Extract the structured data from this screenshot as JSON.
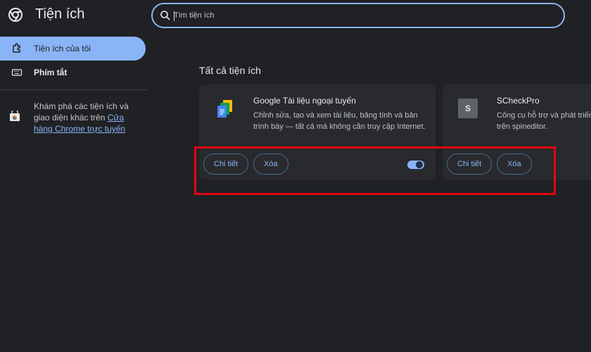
{
  "header": {
    "title": "Tiện ích",
    "logo_icon": "chrome-logo-icon"
  },
  "search": {
    "placeholder": "Tìm tiện ích",
    "icon": "search-icon"
  },
  "sidebar": {
    "items": [
      {
        "label": "Tiện ích của tôi",
        "icon": "extensions-icon",
        "active": true
      },
      {
        "label": "Phím tắt",
        "icon": "keyboard-icon",
        "active": false
      }
    ],
    "promo": {
      "text": "Khám phá các tiện ích và giao diện khác trên ",
      "link": "Cửa hàng Chrome trực tuyến",
      "icon": "chrome-web-store-icon"
    }
  },
  "main": {
    "section_title": "Tất cả tiện ích",
    "extensions": [
      {
        "name": "Google Tài liệu ngoại tuyến",
        "description": "Chỉnh sửa, tạo và xem tài liệu, bảng tính và bản trình bày — tất cả mà không cần truy cập Internet.",
        "icon": "google-docs-icon",
        "details_label": "Chi tiết",
        "remove_label": "Xóa",
        "enabled": true
      },
      {
        "name": "SCheckPro",
        "description": "Công cụ hỗ trợ và phát triển trên spineditor.",
        "badge": "S",
        "details_label": "Chi tiết",
        "remove_label": "Xóa"
      }
    ]
  },
  "colors": {
    "accent": "#8ab4f8",
    "highlight": "#e30613",
    "background": "#202124",
    "card": "#292a2d"
  }
}
